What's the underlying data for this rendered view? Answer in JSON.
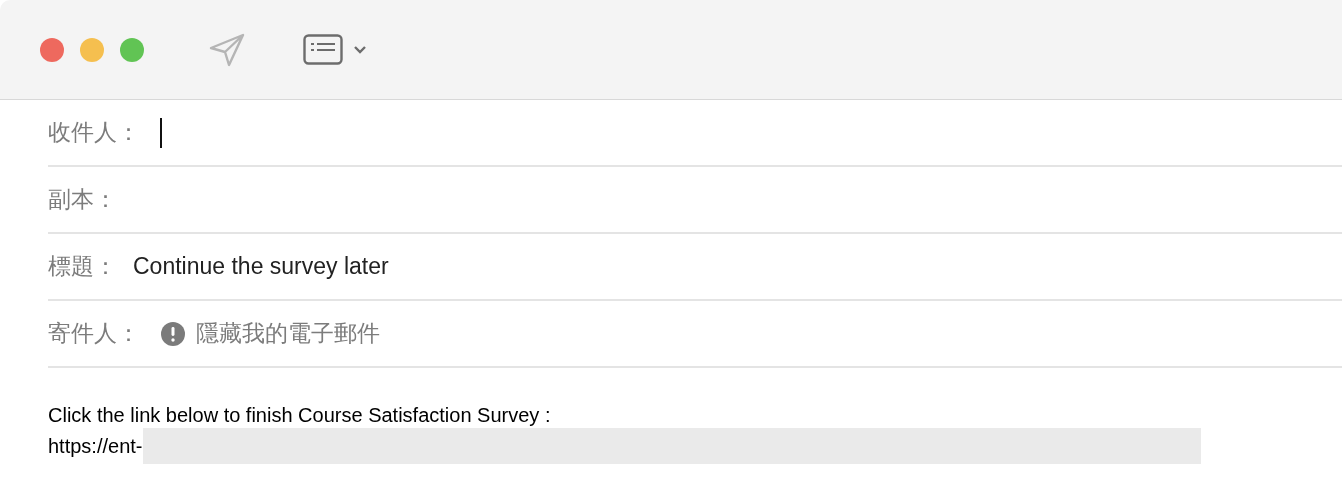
{
  "toolbar": {
    "send_button": {
      "disabled": true
    }
  },
  "header_fields": [
    {
      "kind": "recipients",
      "label": "收件人：",
      "focused": true
    },
    {
      "kind": "recipients",
      "label": "副本：",
      "focused": false
    },
    {
      "kind": "subject",
      "label": "標題：",
      "value": "Continue the survey later",
      "focused": false
    },
    {
      "kind": "sender",
      "label": "寄件人：",
      "value": "隱藏我的電子郵件",
      "focused": false
    }
  ],
  "body": {
    "lines": [
      {
        "kind": "text",
        "text": "Click the link below to finish Course Satisfaction Survey :"
      },
      {
        "kind": "link",
        "text": "https://ent-",
        "redacted": true
      }
    ]
  }
}
